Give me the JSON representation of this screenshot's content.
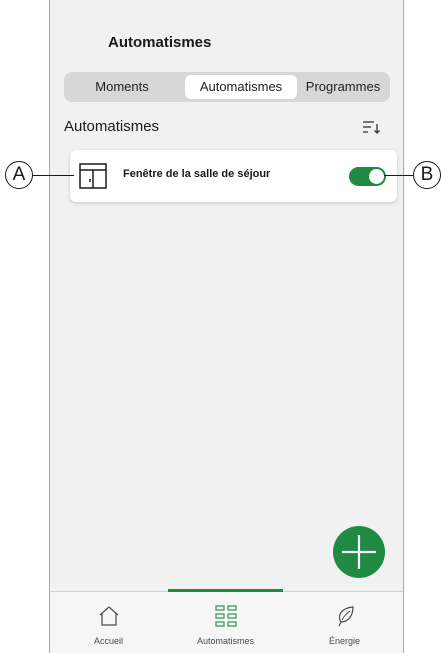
{
  "header": {
    "title": "Automatismes"
  },
  "tabs_segment": {
    "items": [
      {
        "label": "Moments",
        "selected": false
      },
      {
        "label": "Automatismes",
        "selected": true
      },
      {
        "label": "Programmes",
        "selected": false
      }
    ]
  },
  "section": {
    "title": "Automatismes",
    "sort_icon": "sort-icon"
  },
  "automations": [
    {
      "icon": "window-icon",
      "label": "Fenêtre de la salle de séjour",
      "enabled": true
    }
  ],
  "fab": {
    "icon": "plus-icon"
  },
  "bottom_nav": {
    "items": [
      {
        "label": "Accueil",
        "icon": "home-icon",
        "active": false
      },
      {
        "label": "Automatismes",
        "icon": "grid-icon",
        "active": true
      },
      {
        "label": "Énergie",
        "icon": "leaf-icon",
        "active": false
      }
    ]
  },
  "callouts": {
    "a": "A",
    "b": "B"
  },
  "colors": {
    "accent": "#1e8a42",
    "background": "#f1f1f1",
    "card": "#ffffff"
  }
}
